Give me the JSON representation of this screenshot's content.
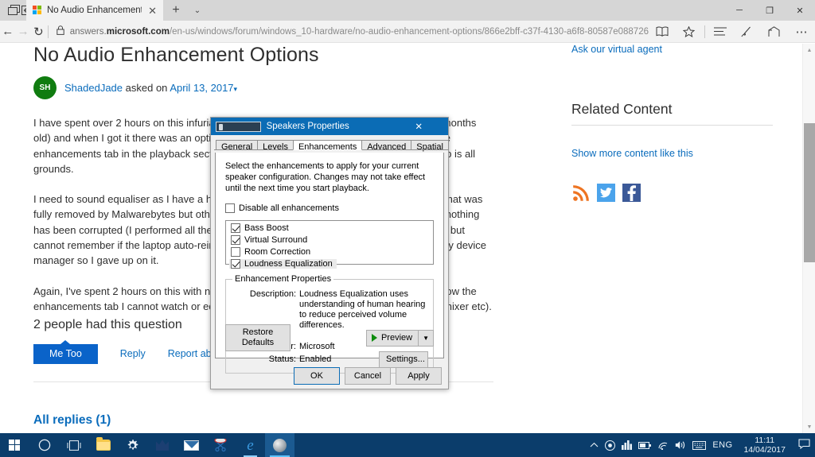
{
  "browser": {
    "tab_title": "No Audio Enhancement",
    "new_tab_label": "+",
    "tab_menu_label": "⌄",
    "back_label": "←",
    "forward_label": "→",
    "refresh_label": "↻",
    "lock_label": "🔒",
    "url_prefix": "answers.",
    "url_domain": "microsoft.com",
    "url_path": "/en-us/windows/forum/windows_10-hardware/no-audio-enhancement-options/866e2bff-c37f-4130-a6f8-80587e088726",
    "minimize_label": "─",
    "maximize_label": "❐",
    "close_label": "✕",
    "reading_view_label": "📖",
    "favorite_label": "☆",
    "hub_label": "☰",
    "web_note_label": "✎",
    "share_label": "↱",
    "more_label": "⋯"
  },
  "page": {
    "title": "No Audio Enhancement Options",
    "avatar_initials": "SH",
    "author": "ShadedJade",
    "asked_on_text": "asked on",
    "asked_date": "April 13, 2017",
    "paragraphs": [
      "I have spent over 2 hours on this infuriating issue with my Lenovo laptop (less than a few months old) and when I got it there was an option. I turned my computer on today and suddenly the enhancements tab in the playback section of sound control there is the “enhancements” tab is all grounds.",
      "I need to sound equaliser as I have a hearing problem. I had a bit of malware a week ago that was fully removed by Malwarebytes but other than that it didn't appear to have any impact and nothing has been corrupted (I performed all the necessary scans). I went SmartAudio HD on there, but cannot remember if the laptop auto-reinstalled on reboot) it and no change. I've checked my device manager so I gave up on it.",
      "Again, I've spent 2 hours on this with no results. Everything is working fine, and yet somehow the enhancements tab I cannot watch or edit (I'm a Youtuber) anything that isn't maxed in the mixer etc)."
    ],
    "question_count": "2 people had this question",
    "me_too_label": "Me Too",
    "reply_label": "Reply",
    "report_abuse_label": "Report abuse",
    "all_replies_label": "All replies (1)"
  },
  "rail": {
    "virtual_agent_link": "Ask our virtual agent",
    "related_heading": "Related Content",
    "show_more_link": "Show more content like this",
    "social": [
      {
        "name": "rss",
        "label": "RSS"
      },
      {
        "name": "twitter",
        "label": "t"
      },
      {
        "name": "facebook",
        "label": "f"
      }
    ]
  },
  "dialog": {
    "title": "Speakers Properties",
    "close_label": "✕",
    "tabs": [
      {
        "label": "General",
        "active": false
      },
      {
        "label": "Levels",
        "active": false
      },
      {
        "label": "Enhancements",
        "active": true
      },
      {
        "label": "Advanced",
        "active": false
      },
      {
        "label": "Spatial sound",
        "active": false
      }
    ],
    "intro": "Select the enhancements to apply for your current speaker configuration. Changes may not take effect until the next time you start playback.",
    "disable_all_label": "Disable all enhancements",
    "disable_all_checked": false,
    "enhancements": [
      {
        "label": "Bass Boost",
        "checked": true,
        "selected": false
      },
      {
        "label": "Virtual Surround",
        "checked": true,
        "selected": false
      },
      {
        "label": "Room Correction",
        "checked": false,
        "selected": false
      },
      {
        "label": "Loudness Equalization",
        "checked": true,
        "selected": true
      }
    ],
    "properties_legend": "Enhancement Properties",
    "description_key": "Description:",
    "description_value": "Loudness Equalization uses understanding of human hearing to reduce perceived volume differences.",
    "provider_key": "Provider:",
    "provider_value": "Microsoft",
    "status_key": "Status:",
    "status_value": "Enabled",
    "settings_label": "Settings...",
    "restore_defaults_label": "Restore Defaults",
    "preview_label": "Preview",
    "preview_dropdown_label": "▼",
    "ok_label": "OK",
    "cancel_label": "Cancel",
    "apply_label": "Apply"
  },
  "taskbar": {
    "start_label": "Start",
    "search_label": "○",
    "task_view_label": "❐",
    "items": [
      {
        "name": "file-explorer",
        "label": "File Explorer"
      },
      {
        "name": "settings",
        "label": "Settings"
      },
      {
        "name": "malwarebytes",
        "label": "M"
      },
      {
        "name": "mail",
        "label": "Mail"
      },
      {
        "name": "snipping-tool",
        "label": "Snipping Tool"
      },
      {
        "name": "microsoft-edge",
        "label": "e"
      },
      {
        "name": "sound-control",
        "label": "Speakers"
      }
    ],
    "tray_show_hidden": "⌃",
    "tray_onedrive": "◉",
    "tray_action": "▥",
    "tray_battery": "▭",
    "tray_network": "◠",
    "tray_volume": "🔊",
    "tray_keyboard": "⌨",
    "language": "ENG",
    "clock_time": "11:11",
    "clock_date": "14/04/2017",
    "notifications": "💬"
  },
  "colors": {
    "accent_blue": "#0b6cb5",
    "link_blue": "#0a6cbc",
    "taskbar_blue": "#0b3d6b",
    "avatar_green": "#107c10"
  }
}
